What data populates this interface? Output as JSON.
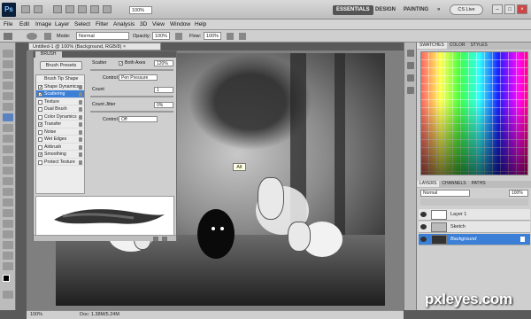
{
  "app": {
    "logo": "Ps"
  },
  "topbar": {
    "zoom": "100%",
    "workspaces": [
      "ESSENTIALS",
      "DESIGN",
      "PAINTING",
      "»"
    ],
    "cslive": "CS Live"
  },
  "menu": [
    "File",
    "Edit",
    "Image",
    "Layer",
    "Select",
    "Filter",
    "Analysis",
    "3D",
    "View",
    "Window",
    "Help"
  ],
  "options": {
    "mode_label": "Mode:",
    "mode_value": "Normal",
    "opacity_label": "Opacity:",
    "opacity_value": "100%",
    "flow_label": "Flow:",
    "flow_value": "100%"
  },
  "document": {
    "tab": "Untitled-1 @ 100% (Background, RGB/8) ×"
  },
  "brush_panel": {
    "tab": "BRUSH",
    "presets_button": "Brush Presets",
    "items": [
      {
        "label": "Brush Tip Shape",
        "checked": null,
        "selected": false
      },
      {
        "label": "Shape Dynamics",
        "checked": true,
        "selected": false
      },
      {
        "label": "Scattering",
        "checked": true,
        "selected": true
      },
      {
        "label": "Texture",
        "checked": false,
        "selected": false
      },
      {
        "label": "Dual Brush",
        "checked": false,
        "selected": false
      },
      {
        "label": "Color Dynamics",
        "checked": false,
        "selected": false
      },
      {
        "label": "Transfer",
        "checked": true,
        "selected": false
      },
      {
        "label": "Noise",
        "checked": false,
        "selected": false
      },
      {
        "label": "Wet Edges",
        "checked": false,
        "selected": false
      },
      {
        "label": "Airbrush",
        "checked": false,
        "selected": false
      },
      {
        "label": "Smoothing",
        "checked": true,
        "selected": false
      },
      {
        "label": "Protect Texture",
        "checked": false,
        "selected": false
      }
    ],
    "scatter_label": "Scatter",
    "both_axes_label": "Both Axes",
    "scatter_value": "120%",
    "control_label": "Control:",
    "control1_value": "Pen Pressure",
    "count_label": "Count",
    "count_value": "1",
    "count_jitter_label": "Count Jitter",
    "count_jitter_value": "0%",
    "control2_value": "Off"
  },
  "tooltip": "Alt",
  "right_panel": {
    "swatch_tabs": [
      "SWATCHES",
      "COLOR",
      "STYLES"
    ],
    "layers_tabs": [
      "LAYERS",
      "CHANNELS",
      "PATHS"
    ],
    "blend_mode": "Normal",
    "opacity": "100%",
    "layers": [
      {
        "name": "Layer 1",
        "selected": false
      },
      {
        "name": "Sketch",
        "selected": false
      },
      {
        "name": "Background",
        "selected": true
      }
    ]
  },
  "status": {
    "zoom": "100%",
    "doc": "Doc: 1.38M/5.24M"
  },
  "watermark": "pxleyes.com"
}
